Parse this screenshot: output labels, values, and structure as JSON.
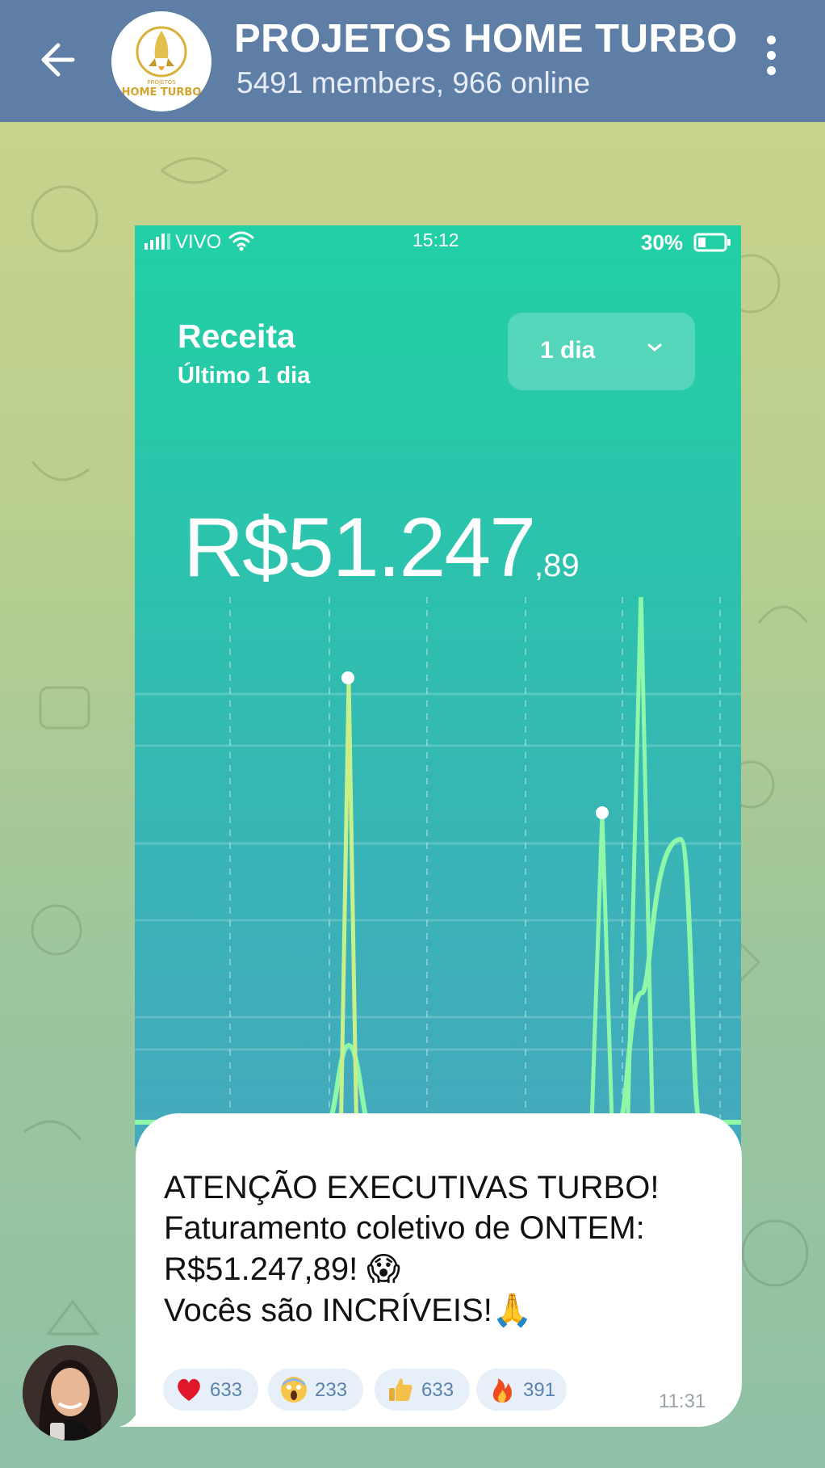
{
  "header": {
    "title": "PROJETOS HOME TURBO",
    "subtitle": "5491 members, 966 online",
    "back_icon": "arrow-left-icon",
    "menu_icon": "more-vertical-icon",
    "avatar_logo_text_top": "PROJETOS",
    "avatar_logo_text": "HOME TURBO",
    "background_color": "#5f7ea6"
  },
  "phone": {
    "status_bar": {
      "carrier": "VIVO",
      "time": "15:12",
      "battery_percent": "30%",
      "battery_level": 0.3
    },
    "card": {
      "title": "Receita",
      "subtitle": "Último 1 dia",
      "period_select": "1 dia"
    },
    "amount_main": "R$51.247",
    "amount_cents": ",89"
  },
  "message": {
    "lines": [
      " ATENÇÃO EXECUTIVAS TURBO!",
      "Faturamento coletivo de ONTEM:",
      "R$51.247,89! 😱",
      "Vocês são INCRÍVEIS!🙏"
    ],
    "time": "11:31",
    "reactions": [
      {
        "emoji": "heart-icon",
        "count": "633"
      },
      {
        "emoji": "screaming-face-icon",
        "count": "233"
      },
      {
        "emoji": "thumbs-up-icon",
        "count": "633"
      },
      {
        "emoji": "fire-icon",
        "count": "391"
      }
    ]
  },
  "colors": {
    "accent_teal": "#22d0a5",
    "line_green": "#7dffa0",
    "reaction_text": "#5a82ad"
  }
}
